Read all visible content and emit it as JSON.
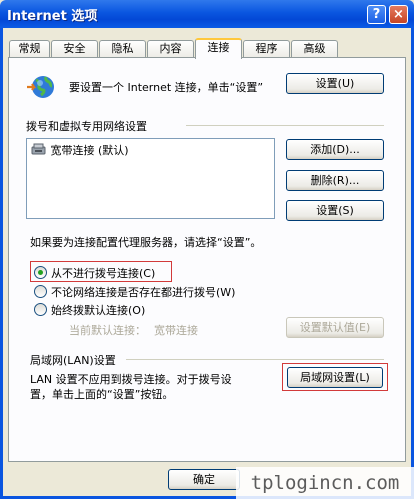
{
  "window": {
    "title": "Internet 选项",
    "help": "?",
    "close": "×"
  },
  "tabs": [
    {
      "label": "常规"
    },
    {
      "label": "安全"
    },
    {
      "label": "隐私"
    },
    {
      "label": "内容"
    },
    {
      "label": "连接",
      "active": true
    },
    {
      "label": "程序"
    },
    {
      "label": "高级"
    }
  ],
  "setup": {
    "text": "要设置一个 Internet 连接，单击“设置”",
    "button": "设置(U)"
  },
  "dialup": {
    "heading": "拨号和虚拟专用网络设置",
    "items": [
      {
        "label": "宽带连接 (默认)"
      }
    ],
    "add_button": "添加(D)...",
    "delete_button": "删除(R)...",
    "settings_button": "设置(S)"
  },
  "proxy_note": "如果要为连接配置代理服务器，请选择“设置”。",
  "radios": [
    {
      "label": "从不进行拨号连接(C)",
      "checked": true
    },
    {
      "label": "不论网络连接是否存在都进行拨号(W)",
      "checked": false
    },
    {
      "label": "始终拨默认连接(O)",
      "checked": false
    }
  ],
  "default_connection": {
    "label": "当前默认连接：",
    "value": "宽带连接",
    "button": "设置默认值(E)"
  },
  "lan": {
    "heading": "局域网(LAN)设置",
    "text_line1": "LAN 设置不应用到拨号连接。对于拨号设",
    "text_line2": "置，单击上面的“设置”按钮。",
    "button": "局域网设置(L)"
  },
  "footer": {
    "ok": "确定"
  },
  "watermark": "tplogincn.com"
}
